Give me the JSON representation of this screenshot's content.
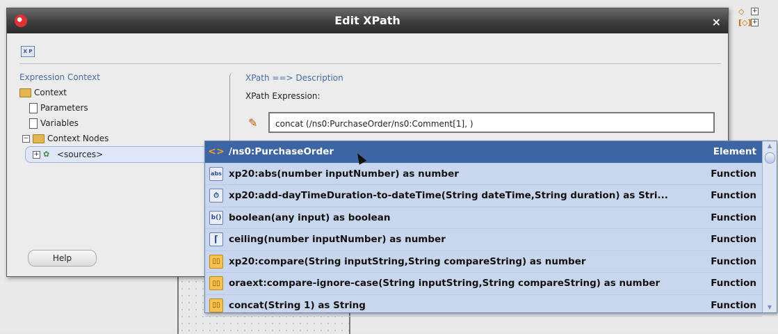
{
  "dialog": {
    "title": "Edit XPath",
    "close_glyph": "×",
    "toolbar_icon": "XPath-icon"
  },
  "left": {
    "header": "Expression Context",
    "tree": [
      {
        "label": "Context"
      },
      {
        "label": "Parameters"
      },
      {
        "label": "Variables"
      },
      {
        "label": "Context Nodes"
      },
      {
        "label": "<sources>"
      }
    ],
    "help_label": "Help"
  },
  "right": {
    "header": "XPath ==> Description",
    "expr_label": "XPath Expression:",
    "expr_value": "concat (/ns0:PurchaseOrder/ns0:Comment[1], )"
  },
  "popup": {
    "items": [
      {
        "icon": "element-icon",
        "glyph": "<>",
        "name": "/ns0:PurchaseOrder",
        "type": "Element"
      },
      {
        "icon": "abs-icon",
        "glyph": "abs",
        "name": "xp20:abs(number inputNumber) as number",
        "type": "Function"
      },
      {
        "icon": "datetime-icon",
        "glyph": "⏱",
        "name": "xp20:add-dayTimeDuration-to-dateTime(String dateTime,String duration) as Stri...",
        "type": "Function"
      },
      {
        "icon": "boolean-icon",
        "glyph": "b()",
        "name": "boolean(any input) as boolean",
        "type": "Function"
      },
      {
        "icon": "ceiling-icon",
        "glyph": "⌈",
        "name": "ceiling(number inputNumber) as number",
        "type": "Function"
      },
      {
        "icon": "compare-icon",
        "glyph": "▯▯",
        "name": "xp20:compare(String inputString,String compareString) as number",
        "type": "Function"
      },
      {
        "icon": "compare-ignore-case-icon",
        "glyph": "▯▯",
        "name": "oraext:compare-ignore-case(String inputString,String compareString) as number",
        "type": "Function"
      },
      {
        "icon": "concat-icon",
        "glyph": "▯▯",
        "name": "concat(String 1) as String",
        "type": "Function"
      }
    ]
  }
}
